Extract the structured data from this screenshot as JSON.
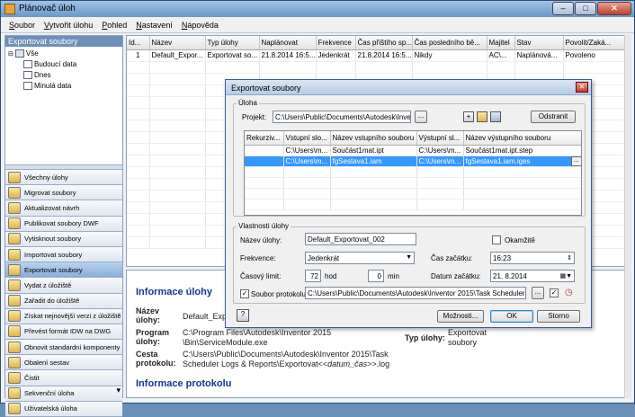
{
  "window": {
    "title": "Plánovač úloh"
  },
  "menu": [
    {
      "accel": "S",
      "rest": "oubor"
    },
    {
      "accel": "V",
      "rest": "ytvořit úlohu"
    },
    {
      "accel": "P",
      "rest": "ohled"
    },
    {
      "accel": "N",
      "rest": "astavení"
    },
    {
      "accel": "N",
      "rest": "ápověda"
    }
  ],
  "sidebar": {
    "header": "Exportovat soubory",
    "tree": {
      "root": "Vše",
      "children": [
        "Budoucí data",
        "Dnes",
        "Minulá data"
      ]
    },
    "items": [
      "Všechny úlohy",
      "Migrovat soubory",
      "Aktualizovat návrh",
      "Publikovat soubory DWF",
      "Vytisknout soubory",
      "Importovat soubory",
      "Exportovat soubory",
      "Vydat z úložiště",
      "Zařadit do úložiště",
      "Získat nejnovější verzi z úložiště",
      "Převést formát IDW na DWG",
      "Obnovit standardní komponenty",
      "Obalení sestav",
      "Čistit",
      "Sekvenční úloha",
      "Uživatelská úloha"
    ],
    "active_index": 6
  },
  "grid": {
    "columns": [
      "Id...",
      "Název",
      "Typ úlohy",
      "Naplánovat",
      "Frekvence",
      "Čas příštího sp...",
      "Čas posledního bě...",
      "Majitel",
      "Stav",
      "Povolit/Zaká..."
    ],
    "rows": [
      [
        "1",
        "Default_Expor...",
        "Exportovat so...",
        "21.8.2014 16:5...",
        "Jedenkrát",
        "21.8.2014 16:5...",
        "Nikdy",
        "AC\\...",
        "Naplánová...",
        "Povoleno"
      ]
    ]
  },
  "details": {
    "section1": "Informace úlohy",
    "name_label": "Název úlohy:",
    "name_value": "Default_Exp",
    "program_label": "Program úlohy:",
    "program_value_1": "C:\\Program Files\\Autodesk\\Inventor 2015",
    "program_value_2": "\\Bin\\ServiceModule.exe",
    "path_label": "Cesta protokolu:",
    "path_value_1": "C:\\Users\\Public\\Documents\\Autodesk\\Inventor 2015\\Task",
    "path_value_2_prefix": "Scheduler Logs & Reports\\Exportovat<<",
    "path_value_2_italic": "datum_čas",
    "path_value_2_suffix": ">>.log",
    "type_label": "Typ úlohy:",
    "type_value_1": "Exportovat",
    "type_value_2": "soubory",
    "section2": "Informace protokolu"
  },
  "dialog": {
    "title": "Exportovat soubory",
    "group_task": "Úloha",
    "project_label": "Projekt:",
    "project_value": "C:\\Users\\Public\\Documents\\Autodesk\\Inventor 2",
    "browse": "...",
    "remove_button": "Odstranit",
    "file_columns": [
      "Rekurziv...",
      "Vstupní slo...",
      "Název vstupního souboru",
      "Výstupní sl...",
      "Název výstupního souboru"
    ],
    "file_rows": [
      [
        "",
        "C:\\Users\\m...",
        "Součást1mat.ipt",
        "C:\\Users\\m...",
        "Součást1mat.ipt.step"
      ],
      [
        "",
        "C:\\Users\\m...",
        "fgSestava1.iam",
        "C:\\Users\\m...",
        "fgSestava1.iam.iges"
      ]
    ],
    "row_browse": "...",
    "group_props": "Vlastnosti úlohy",
    "name_label": "Název úlohy:",
    "name_value": "Default_Exportovat_002",
    "immediately_label": "Okamžitě",
    "frequency_label": "Frekvence:",
    "frequency_value": "Jedenkrát",
    "start_time_label": "Čas začátku:",
    "start_time_value": "16:23",
    "time_limit_label": "Časový limit:",
    "time_limit_hours": "72",
    "hours_unit": "hod",
    "time_limit_minutes": "0",
    "minutes_unit": "min",
    "start_date_label": "Datum začátku:",
    "start_date_value": "21.  8.2014",
    "log_label": "Soubor protokolu:",
    "log_value": "C:\\Users\\Public\\Documents\\Autodesk\\Inventor 2015\\Task Scheduler Logs &",
    "options_button": "Možnosti...",
    "ok_button": "OK",
    "cancel_button": "Storno",
    "help_icon": "help-icon"
  }
}
